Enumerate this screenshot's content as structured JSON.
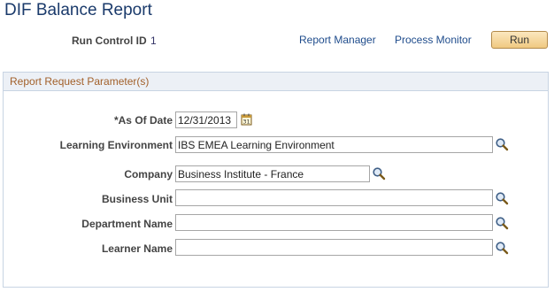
{
  "page": {
    "title": "DIF Balance Report"
  },
  "run_control": {
    "label": "Run Control ID",
    "value": "1"
  },
  "links": {
    "report_manager": "Report Manager",
    "process_monitor": "Process Monitor"
  },
  "toolbar": {
    "run_label": "Run"
  },
  "params": {
    "title": "Report Request Parameter(s)",
    "as_of_date": {
      "label": "*As Of Date",
      "value": "12/31/2013"
    },
    "learning_environment": {
      "label": "Learning Environment",
      "value": "IBS EMEA Learning Environment"
    },
    "company": {
      "label": "Company",
      "value": "Business Institute - France"
    },
    "business_unit": {
      "label": "Business Unit",
      "value": ""
    },
    "department_name": {
      "label": "Department Name",
      "value": ""
    },
    "learner_name": {
      "label": "Learner Name",
      "value": ""
    }
  },
  "icons": {
    "calendar": "calendar-icon",
    "lookup": "magnifier-lookup-icon"
  },
  "colors": {
    "title": "#1a3a6b",
    "link": "#1f4c8c",
    "group_title": "#a2602a",
    "group_header_bg": "#ecf0f6",
    "run_button": "#f0c981"
  }
}
